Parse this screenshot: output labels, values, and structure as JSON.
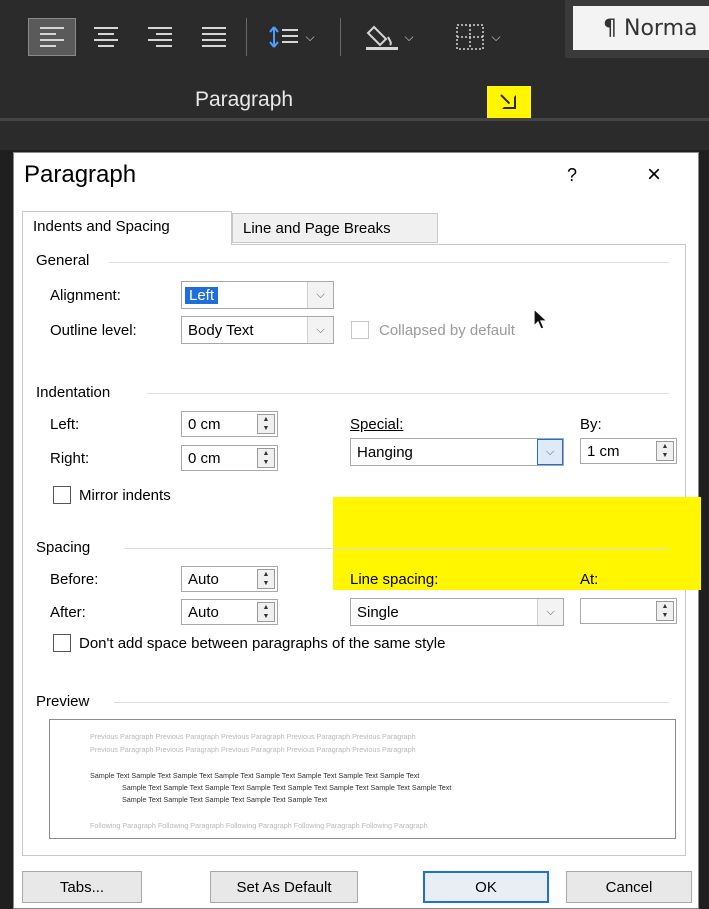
{
  "ribbon": {
    "group_label": "Paragraph",
    "style_preview": "¶ Norma",
    "icons": [
      "align-left-icon",
      "center-icon",
      "align-right-icon",
      "justify-icon",
      "line-spacing-icon",
      "shading-icon",
      "borders-icon",
      "dialog-launcher-icon"
    ],
    "highlight_color": "#fff600"
  },
  "dialog": {
    "title": "Paragraph",
    "help": "?",
    "close": "×",
    "tabs": [
      {
        "label": "Indents and Spacing"
      },
      {
        "label": "Line and Page Breaks"
      }
    ],
    "general": {
      "heading": "General",
      "alignment_label": "Alignment:",
      "alignment_value": "Left",
      "outline_label": "Outline level:",
      "outline_value": "Body Text",
      "collapsed_label": "Collapsed by default"
    },
    "indentation": {
      "heading": "Indentation",
      "left_label": "Left:",
      "left_value": "0 cm",
      "right_label": "Right:",
      "right_value": "0 cm",
      "special_label": "Special:",
      "special_value": "Hanging",
      "by_label": "By:",
      "by_value": "1 cm",
      "mirror_label": "Mirror indents"
    },
    "spacing": {
      "heading": "Spacing",
      "before_label": "Before:",
      "before_value": "Auto",
      "after_label": "After:",
      "after_value": "Auto",
      "line_spacing_label": "Line spacing:",
      "line_spacing_value": "Single",
      "at_label": "At:",
      "at_value": "",
      "dont_add_label": "Don't add space between paragraphs of the same style"
    },
    "preview": {
      "heading": "Preview",
      "prev1": "Previous Paragraph Previous Paragraph Previous Paragraph Previous Paragraph Previous Paragraph",
      "prev2": "Previous Paragraph Previous Paragraph Previous Paragraph Previous Paragraph Previous Paragraph",
      "sample1": "Sample Text Sample Text Sample Text Sample Text Sample Text Sample Text Sample Text Sample Text",
      "sample2": "Sample Text Sample Text Sample Text Sample Text Sample Text Sample Text Sample Text Sample Text",
      "sample3": "Sample Text Sample Text Sample Text Sample Text Sample Text",
      "follow": "Following Paragraph Following Paragraph Following Paragraph Following Paragraph Following Paragraph"
    },
    "buttons": {
      "tabs": "Tabs...",
      "set_default": "Set As Default",
      "ok": "OK",
      "cancel": "Cancel"
    },
    "accent_color": "#1e6fd9"
  }
}
